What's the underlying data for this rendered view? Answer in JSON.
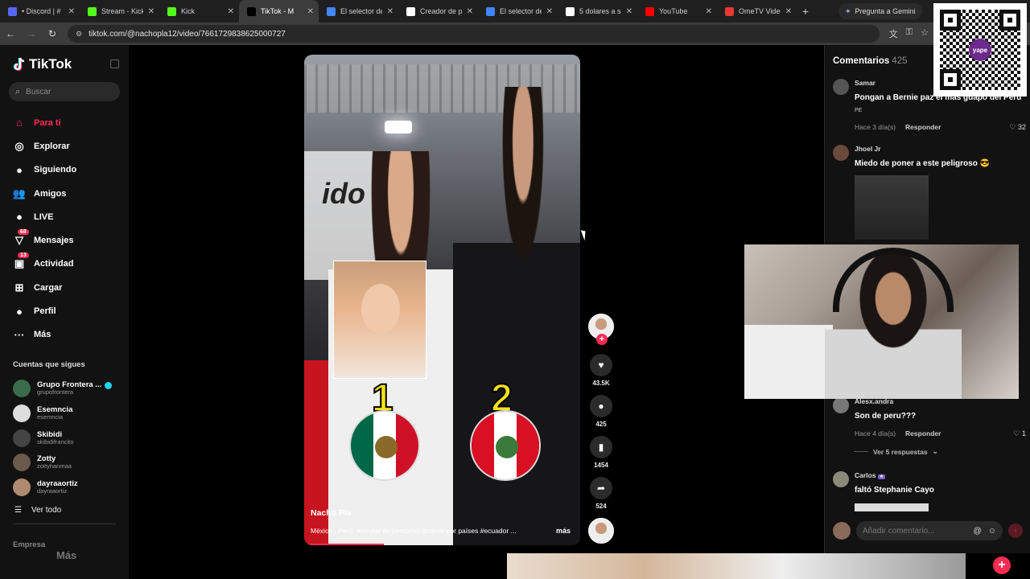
{
  "browser": {
    "tabs": [
      {
        "label": "• Discord | #",
        "color": "#5865f2",
        "active": false
      },
      {
        "label": "Stream - Kick",
        "color": "#53fc18",
        "active": false
      },
      {
        "label": "Kick",
        "color": "#53fc18",
        "active": false
      },
      {
        "label": "TikTok - M",
        "color": "#000000",
        "active": true
      },
      {
        "label": "El selector de",
        "color": "#4285f4",
        "active": false
      },
      {
        "label": "Creador de pa",
        "color": "#ffffff",
        "active": false
      },
      {
        "label": "El selector de",
        "color": "#4285f4",
        "active": false
      },
      {
        "label": "5 dolares a so",
        "color": "#ffffff",
        "active": false
      },
      {
        "label": "YouTube",
        "color": "#ff0000",
        "active": false
      },
      {
        "label": "OmeTV Video",
        "color": "#e53935",
        "active": false
      }
    ],
    "gemini_label": "Pregunta a Gemini",
    "url": "tiktok.com/@nachopla12/video/7661729838625000727"
  },
  "sidebar": {
    "brand": "TikTok",
    "search_placeholder": "Buscar",
    "menu": [
      {
        "label": "Para ti",
        "icon": "home-icon",
        "glyph": "⌂",
        "active": true
      },
      {
        "label": "Explorar",
        "icon": "compass-icon",
        "glyph": "◎",
        "active": false
      },
      {
        "label": "Siguiendo",
        "icon": "following-icon",
        "glyph": "●",
        "active": false
      },
      {
        "label": "Amigos",
        "icon": "friends-icon",
        "glyph": "👥",
        "active": false
      },
      {
        "label": "LIVE",
        "icon": "live-icon",
        "glyph": "●",
        "active": false
      },
      {
        "label": "Mensajes",
        "icon": "messages-icon",
        "glyph": "▽",
        "badge": "68",
        "active": false
      },
      {
        "label": "Actividad",
        "icon": "activity-icon",
        "glyph": "▣",
        "badge": "13",
        "active": false
      },
      {
        "label": "Cargar",
        "icon": "upload-icon",
        "glyph": "⊞",
        "active": false
      },
      {
        "label": "Perfil",
        "icon": "profile-icon",
        "glyph": "●",
        "active": false
      },
      {
        "label": "Más",
        "icon": "more-icon",
        "glyph": "···",
        "active": false
      }
    ],
    "following_title": "Cuentas que sigues",
    "following": [
      {
        "name": "Grupo Frontera ...",
        "handle": "grupofrontera",
        "verified": true,
        "color": "#3a6b4a"
      },
      {
        "name": "Esemncia",
        "handle": "esemncia",
        "verified": false,
        "color": "#dddddd"
      },
      {
        "name": "Skibidi",
        "handle": "skibidifrancito",
        "verified": false,
        "color": "#444444"
      },
      {
        "name": "Zotty",
        "handle": "zottyhanmaa",
        "verified": false,
        "color": "#6a5a4a"
      },
      {
        "name": "dayraaortiz",
        "handle": "dayraaortiz",
        "verified": false,
        "color": "#b08a70"
      }
    ],
    "see_all": "Ver todo",
    "company": "Empresa",
    "mas_ghost": "Más"
  },
  "video": {
    "author": "Nacho Pla",
    "description": "México - Perú: mundial de personas guapas por países #ecuador ...",
    "more": "más",
    "overlay_numbers": [
      "1",
      "2"
    ],
    "backdrop_text": "ido",
    "progress": 0.29
  },
  "actions": {
    "likes": "43.5K",
    "comments": "425",
    "saves": "1454",
    "shares": "524"
  },
  "comments_panel": {
    "title": "Comentarios",
    "count": "425",
    "items": [
      {
        "user": "Samar",
        "text": "Pongan a Bernie paz el más guapo del Perú",
        "flag_text": "PE",
        "time": "Hace 3 día(s)",
        "reply": "Responder",
        "likes": "32",
        "avatar_color": "#555555"
      },
      {
        "user": "Jhoel Jr",
        "text": "Miedo de poner a este peligroso 😎",
        "time": "",
        "reply": "",
        "likes": "",
        "avatar_color": "#6a4a3a"
      },
      {
        "user": "Alesx.andra",
        "text": "Son de peru???",
        "time": "Hace 4 día(s)",
        "reply": "Responder",
        "likes": "1",
        "avatar_color": "#777777"
      },
      {
        "user": "Carlos",
        "text": "faltó Stephanie Cayo",
        "time": "",
        "reply": "",
        "likes": "",
        "avatar_color": "#8a8a7a"
      }
    ],
    "view_replies": "Ver 5 respuestas",
    "input_placeholder": "Añadir comentario..."
  },
  "qr": {
    "logo_text": "yape"
  }
}
